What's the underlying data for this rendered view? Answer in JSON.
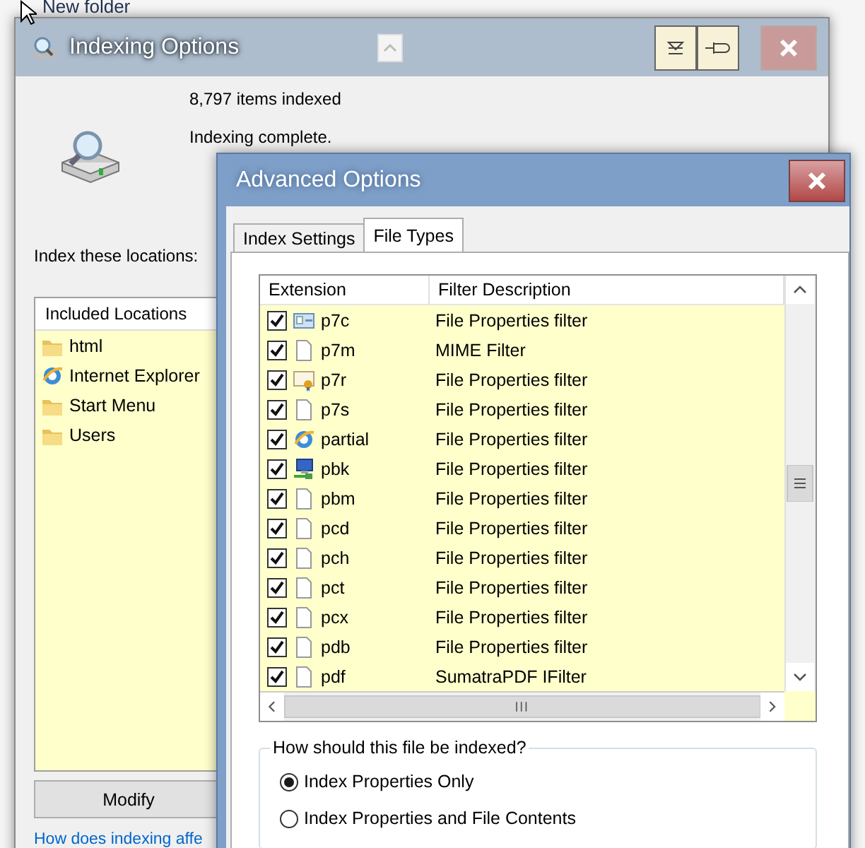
{
  "background_window": {
    "folder_name": "New folder"
  },
  "indexing_window": {
    "title": "Indexing Options",
    "items_indexed": "8,797 items indexed",
    "status": "Indexing complete.",
    "locations_label": "Index these locations:",
    "locations": {
      "header": "Included Locations",
      "items": [
        {
          "name": "html",
          "kind": "folder"
        },
        {
          "name": "Internet Explorer",
          "kind": "browser"
        },
        {
          "name": "Start Menu",
          "kind": "folder"
        },
        {
          "name": "Users",
          "kind": "folder"
        }
      ]
    },
    "modify_button": "Modify",
    "help_link": "How does indexing affe"
  },
  "advanced_dialog": {
    "title": "Advanced Options",
    "tabs": [
      {
        "label": "Index Settings",
        "selected": false
      },
      {
        "label": "File Types",
        "selected": true
      }
    ],
    "table": {
      "columns": [
        "Extension",
        "Filter Description"
      ],
      "rows": [
        {
          "extension": "p7c",
          "filter": "File Properties filter",
          "checked": true,
          "kind": "card"
        },
        {
          "extension": "p7m",
          "filter": "MIME Filter",
          "checked": true,
          "kind": "file"
        },
        {
          "extension": "p7r",
          "filter": "File Properties filter",
          "checked": true,
          "kind": "certificate"
        },
        {
          "extension": "p7s",
          "filter": "File Properties filter",
          "checked": true,
          "kind": "file"
        },
        {
          "extension": "partial",
          "filter": "File Properties filter",
          "checked": true,
          "kind": "browser"
        },
        {
          "extension": "pbk",
          "filter": "File Properties filter",
          "checked": true,
          "kind": "network"
        },
        {
          "extension": "pbm",
          "filter": "File Properties filter",
          "checked": true,
          "kind": "file"
        },
        {
          "extension": "pcd",
          "filter": "File Properties filter",
          "checked": true,
          "kind": "file"
        },
        {
          "extension": "pch",
          "filter": "File Properties filter",
          "checked": true,
          "kind": "file"
        },
        {
          "extension": "pct",
          "filter": "File Properties filter",
          "checked": true,
          "kind": "file"
        },
        {
          "extension": "pcx",
          "filter": "File Properties filter",
          "checked": true,
          "kind": "file"
        },
        {
          "extension": "pdb",
          "filter": "File Properties filter",
          "checked": true,
          "kind": "file"
        },
        {
          "extension": "pdf",
          "filter": "SumatraPDF IFilter",
          "checked": true,
          "kind": "file"
        }
      ]
    },
    "index_group": {
      "title": "How should this file be indexed?",
      "options": [
        {
          "label": "Index Properties Only",
          "selected": true
        },
        {
          "label": "Index Properties and File Contents",
          "selected": false
        }
      ]
    }
  }
}
